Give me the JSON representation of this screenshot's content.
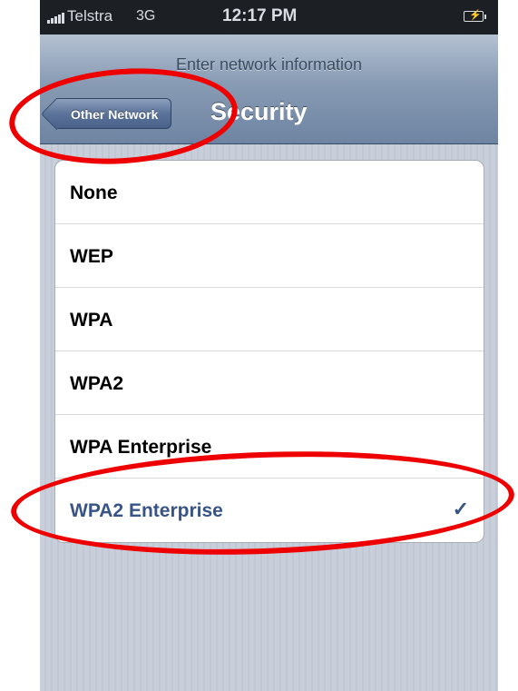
{
  "status_bar": {
    "carrier": "Telstra",
    "network_type": "3G",
    "time": "12:17 PM",
    "battery_icon": "battery-charging-icon"
  },
  "nav_bar": {
    "prompt": "Enter network information",
    "back_label": "Other Network",
    "title": "Security"
  },
  "security_options": [
    {
      "label": "None",
      "selected": false
    },
    {
      "label": "WEP",
      "selected": false
    },
    {
      "label": "WPA",
      "selected": false
    },
    {
      "label": "WPA2",
      "selected": false
    },
    {
      "label": "WPA Enterprise",
      "selected": false
    },
    {
      "label": "WPA2 Enterprise",
      "selected": true,
      "checkmark": "✓"
    }
  ],
  "colors": {
    "selected_text": "#385487",
    "annotation": "#ee0000",
    "nav_bar": "#6e84a2"
  }
}
